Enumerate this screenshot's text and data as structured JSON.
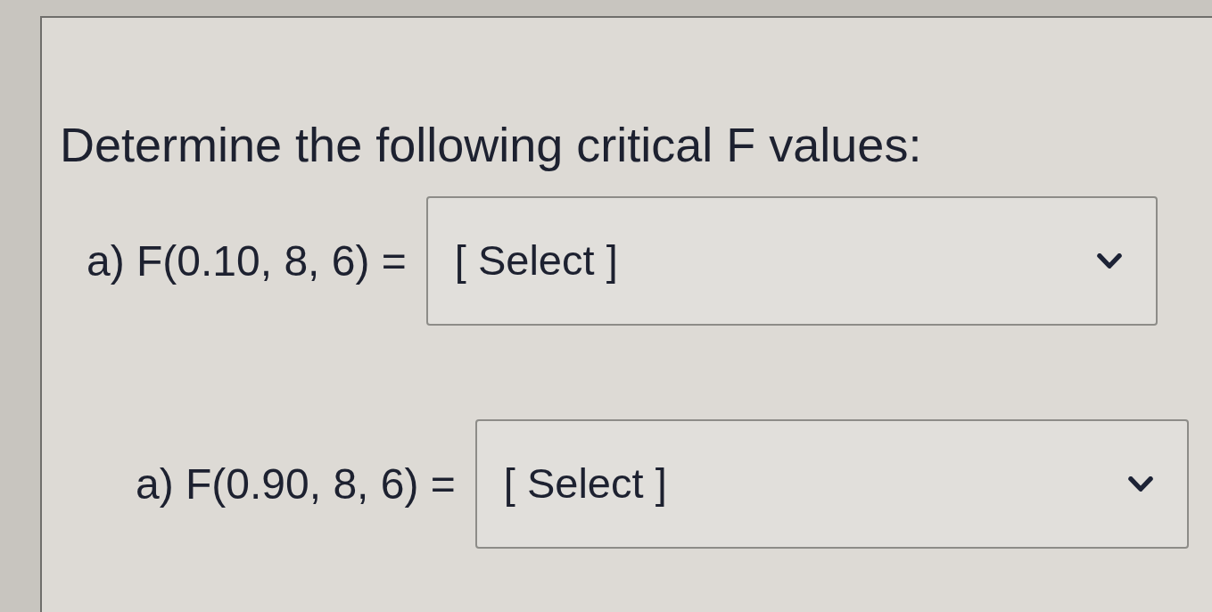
{
  "heading": "Determine the following critical F values:",
  "questions": [
    {
      "label": "a) F(0.10, 8, 6) =",
      "dropdown": {
        "value": "[ Select ]"
      }
    },
    {
      "label": "a) F(0.90, 8, 6) =",
      "dropdown": {
        "value": "[ Select ]"
      }
    }
  ]
}
